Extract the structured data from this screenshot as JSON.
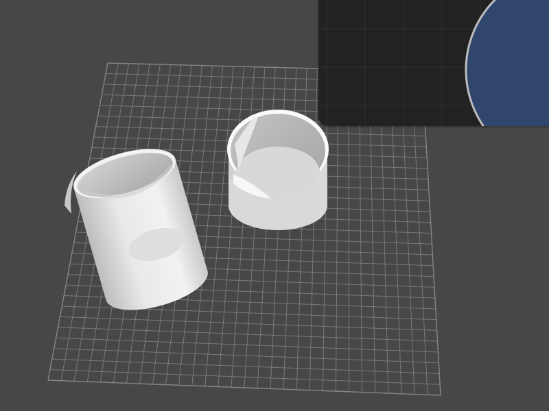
{
  "scene": {
    "background_color": "#474747",
    "grid": {
      "visible": true,
      "color": "#8a8a8a",
      "divisions": 30
    },
    "objects": [
      {
        "name": "tall-cylinder",
        "type": "cylinder",
        "color": "#e6e6e6"
      },
      {
        "name": "short-cylinder",
        "type": "cylinder",
        "color": "#e6e6e6"
      }
    ]
  },
  "preview": {
    "background_color": "#222222",
    "grid_color": "#2f2f2f",
    "shape": {
      "type": "circle",
      "fill": "#30466c",
      "stroke": "#bdbdbd"
    }
  }
}
